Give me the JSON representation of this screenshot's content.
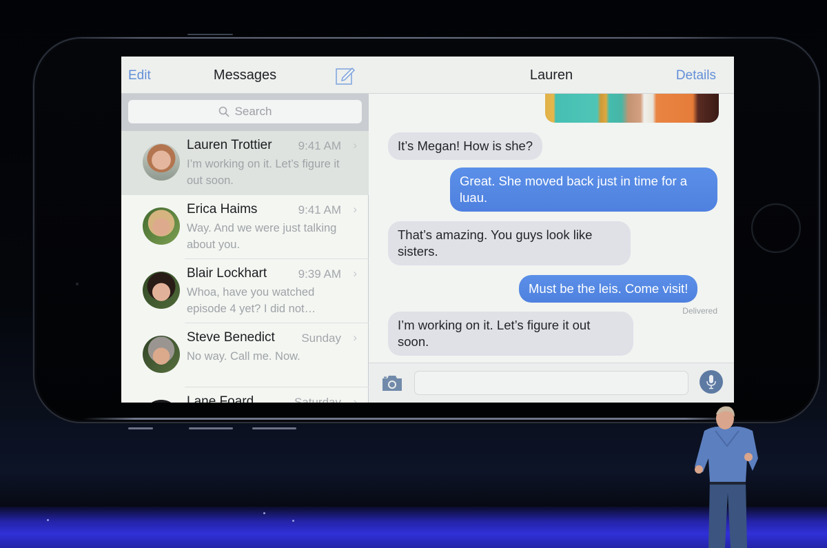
{
  "scene": {
    "description": "Keynote stage with a large projected smartphone showing a Messages app in landscape split view; presenter standing at lower right",
    "colors": {
      "accent_blue": "#5d8fe0",
      "outgoing_bubble": "#4f87ee",
      "incoming_bubble": "#e0e0e8",
      "stage_floor": "#3030d8"
    }
  },
  "messages_list": {
    "nav": {
      "edit_label": "Edit",
      "title": "Messages",
      "compose_icon": "compose-icon"
    },
    "search": {
      "placeholder": "Search",
      "icon": "search-icon"
    },
    "conversations": [
      {
        "name": "Lauren Trottier",
        "time": "9:41 AM",
        "preview": "I’m working on it. Let’s figure it out soon.",
        "selected": true
      },
      {
        "name": "Erica Haims",
        "time": "9:41 AM",
        "preview": "Way. And we were just talking about you.",
        "selected": false
      },
      {
        "name": "Blair Lockhart",
        "time": "9:39 AM",
        "preview": "Whoa, have you watched episode 4 yet? I did not…",
        "selected": false
      },
      {
        "name": "Steve Benedict",
        "time": "Sunday",
        "preview": "No way. Call me. Now.",
        "selected": false
      },
      {
        "name": "Lane Foard",
        "time": "Saturday",
        "preview": "",
        "selected": false
      }
    ],
    "chevron": "›"
  },
  "chat": {
    "nav": {
      "title": "Lauren",
      "details_label": "Details"
    },
    "messages": [
      {
        "direction": "in",
        "text": "It’s Megan! How is she?"
      },
      {
        "direction": "out",
        "text": "Great. She moved back just in time for a luau."
      },
      {
        "direction": "in",
        "text": "That’s amazing. You guys look like sisters."
      },
      {
        "direction": "out",
        "text": "Must be the leis. Come visit!"
      },
      {
        "direction": "in",
        "text": "I’m working on it. Let’s figure it out soon."
      }
    ],
    "status": "Delivered",
    "input": {
      "value": "",
      "placeholder": "",
      "camera_icon": "camera-icon",
      "mic_icon": "microphone-icon"
    }
  }
}
